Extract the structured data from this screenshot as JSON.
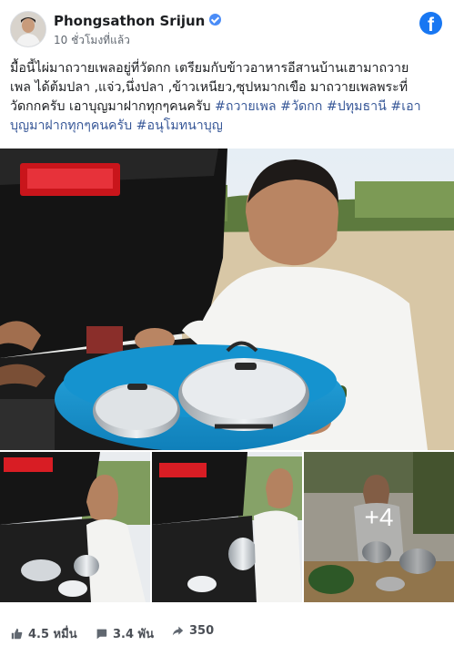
{
  "post": {
    "author": "Phongsathon Srijun",
    "time": "10 ชั่วโมงที่แล้ว",
    "text_lines": [
      "มื้อนี้ไผ่มาถวายเพลอยู่ที่วัดกก เตรียมกับข้าวอาหารอีสานบ้านเฮามาถวาย",
      "เพล ได้ต้มปลา ,แจ่ว,นึ่งปลา ,ข้าวเหนียว,ซุปหมากเขือ มาถวายเพลพระที่"
    ],
    "text_line3_plain": "วัดกกครับ เอาบุญมาฝากทุกๆคนครับ ",
    "hashtags_line3": [
      "#ถวายเพล",
      "#วัดกก",
      "#ปทุมธานี",
      "#เอา"
    ],
    "hashtags_line4": [
      "บุญมาฝากทุกๆคนครับ",
      "#อนุโมทนาบุญ"
    ],
    "more_photos": "+4"
  },
  "stats": {
    "likes": "4.5 หมื่น",
    "comments": "3.4 พัน",
    "shares": "350"
  },
  "icons": [
    "facebook-logo-icon",
    "verified-badge-icon",
    "like-icon",
    "comment-icon",
    "share-icon"
  ],
  "colors": {
    "link": "#385898",
    "facebook_blue": "#1877f2",
    "verified": "#4a8cf7",
    "meta_text": "#606770"
  }
}
